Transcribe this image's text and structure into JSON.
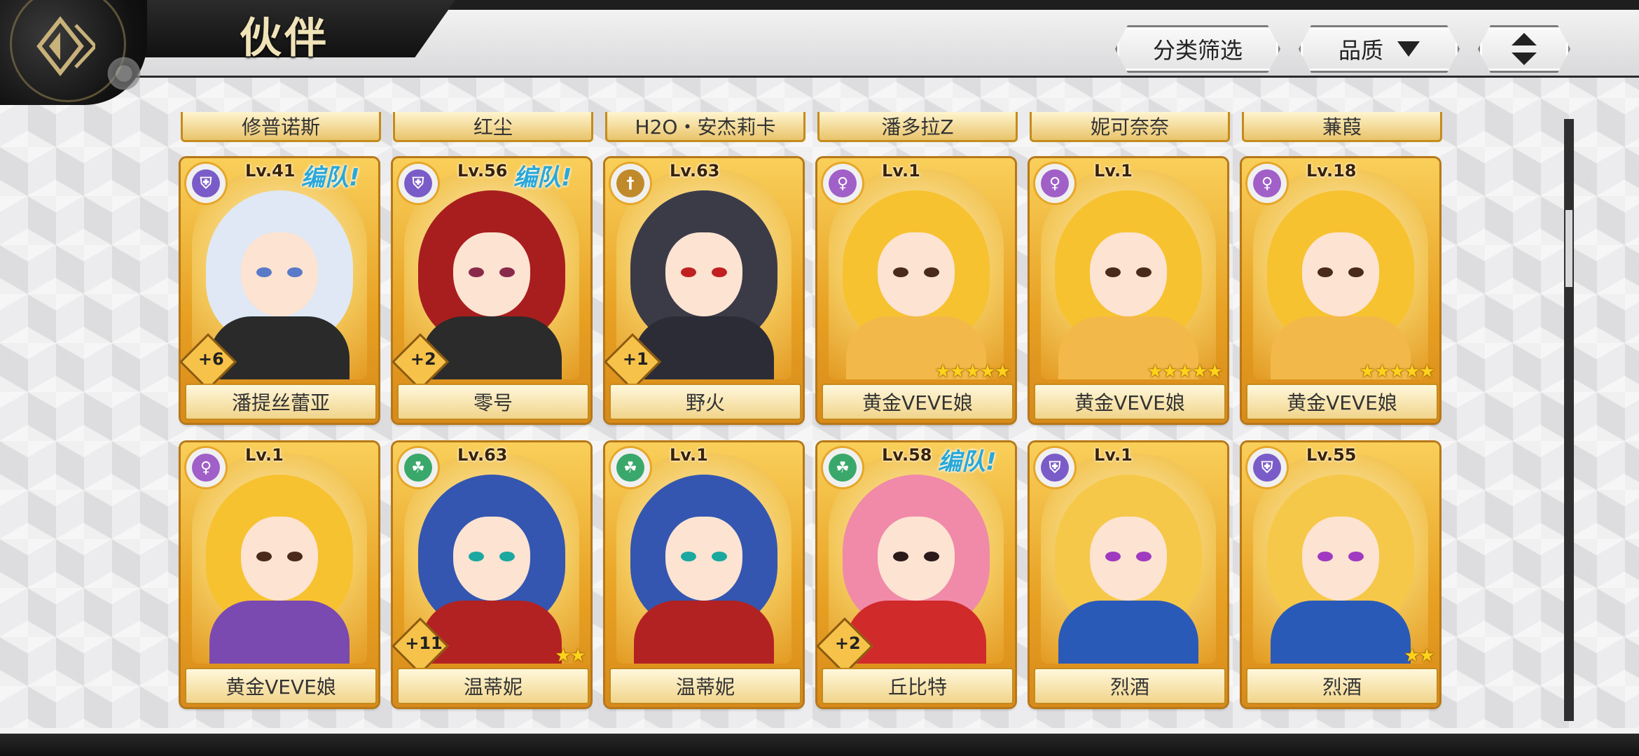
{
  "header": {
    "title": "伙伴",
    "filter_label": "分类筛选",
    "sort_label": "品质",
    "order_icon": "sort-order-icon"
  },
  "partial_row": [
    "修普诺斯",
    "红尘",
    "H2O・安杰莉卡",
    "潘多拉Z",
    "妮可奈奈",
    "蒹葭"
  ],
  "cards": [
    {
      "name": "潘提丝蕾亚",
      "level": "Lv.41",
      "team": "编队!",
      "plus": "+6",
      "stars": "",
      "class": "shield",
      "class_color": "#7a5cc8",
      "hair": "#dfe8f4",
      "eye": "#5a7ac8",
      "body": "#2a2a2a"
    },
    {
      "name": "零号",
      "level": "Lv.56",
      "team": "编队!",
      "plus": "+2",
      "stars": "",
      "class": "shield",
      "class_color": "#7a5cc8",
      "hair": "#a81e1e",
      "eye": "#8a2a4a",
      "body": "#2b2b2b"
    },
    {
      "name": "野火",
      "level": "Lv.63",
      "team": "",
      "plus": "+1",
      "stars": "",
      "class": "sword",
      "class_color": "#c08a2a",
      "hair": "#3b3b48",
      "eye": "#c02020",
      "body": "#2c2c36"
    },
    {
      "name": "黄金VEVE娘",
      "level": "Lv.1",
      "team": "",
      "plus": "",
      "stars": "★★★★★",
      "class": "venus",
      "class_color": "#a060c8",
      "hair": "#f7c230",
      "eye": "#4a2a1a",
      "body": "#f2b84a"
    },
    {
      "name": "黄金VEVE娘",
      "level": "Lv.1",
      "team": "",
      "plus": "",
      "stars": "★★★★★",
      "class": "venus",
      "class_color": "#a060c8",
      "hair": "#f7c230",
      "eye": "#4a2a1a",
      "body": "#f2b84a"
    },
    {
      "name": "黄金VEVE娘",
      "level": "Lv.18",
      "team": "",
      "plus": "",
      "stars": "★★★★★",
      "class": "venus",
      "class_color": "#a060c8",
      "hair": "#f7c230",
      "eye": "#4a2a1a",
      "body": "#f2b84a"
    },
    {
      "name": "黄金VEVE娘",
      "level": "Lv.1",
      "team": "",
      "plus": "",
      "stars": "",
      "class": "venus",
      "class_color": "#a060c8",
      "hair": "#f7c230",
      "eye": "#4a2a1a",
      "body": "#7a4ab0"
    },
    {
      "name": "温蒂妮",
      "level": "Lv.63",
      "team": "",
      "plus": "+11",
      "stars": "★★",
      "class": "clover",
      "class_color": "#3aa86a",
      "hair": "#3456b0",
      "eye": "#1aa8a0",
      "body": "#b22222"
    },
    {
      "name": "温蒂妮",
      "level": "Lv.1",
      "team": "",
      "plus": "",
      "stars": "",
      "class": "clover",
      "class_color": "#3aa86a",
      "hair": "#3456b0",
      "eye": "#1aa8a0",
      "body": "#b22222"
    },
    {
      "name": "丘比特",
      "level": "Lv.58",
      "team": "编队!",
      "plus": "+2",
      "stars": "",
      "class": "clover",
      "class_color": "#3aa86a",
      "hair": "#f08aa8",
      "eye": "#2a1a1a",
      "body": "#d02a2a"
    },
    {
      "name": "烈酒",
      "level": "Lv.1",
      "team": "",
      "plus": "",
      "stars": "",
      "class": "shield",
      "class_color": "#7a5cc8",
      "hair": "#f6c84a",
      "eye": "#a03ac0",
      "body": "#2a5ab8"
    },
    {
      "name": "烈酒",
      "level": "Lv.55",
      "team": "",
      "plus": "",
      "stars": "★★",
      "class": "shield",
      "class_color": "#7a5cc8",
      "hair": "#f6c84a",
      "eye": "#a03ac0",
      "body": "#2a5ab8"
    }
  ]
}
